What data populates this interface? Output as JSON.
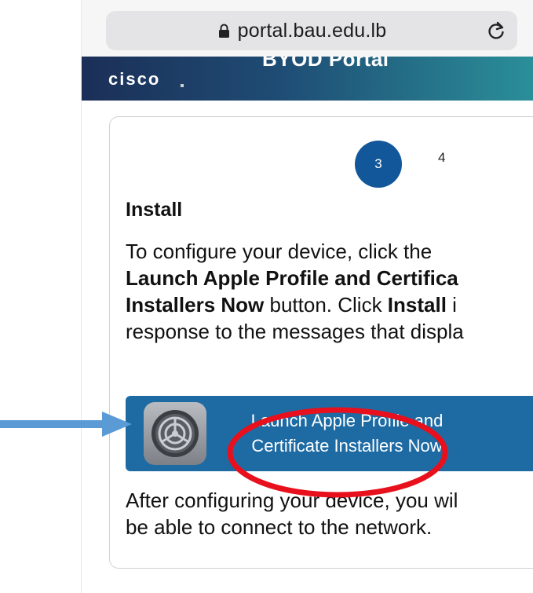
{
  "browser": {
    "url": "portal.bau.edu.lb"
  },
  "banner": {
    "logo_text": "cisco",
    "title": "BYOD Portal"
  },
  "steps": {
    "current": "3",
    "next": "4"
  },
  "install": {
    "heading": "Install",
    "body_lines": [
      "To configure your device, click the",
      "Launch Apple Profile and Certifica",
      "Installers Now button. Click Install i",
      "response to the messages that displa"
    ],
    "launch_button_lines": [
      "Launch Apple Profile and",
      "Certificate Installers Now"
    ],
    "after_lines": [
      "After configuring your device, you wil",
      "be able to connect to the network."
    ]
  },
  "annotations": {
    "arrow_color": "#5b9bd5",
    "ellipse_color": "#e8101c"
  },
  "theme": {
    "accent": "#1e6ba4",
    "step_active": "#12579a"
  }
}
